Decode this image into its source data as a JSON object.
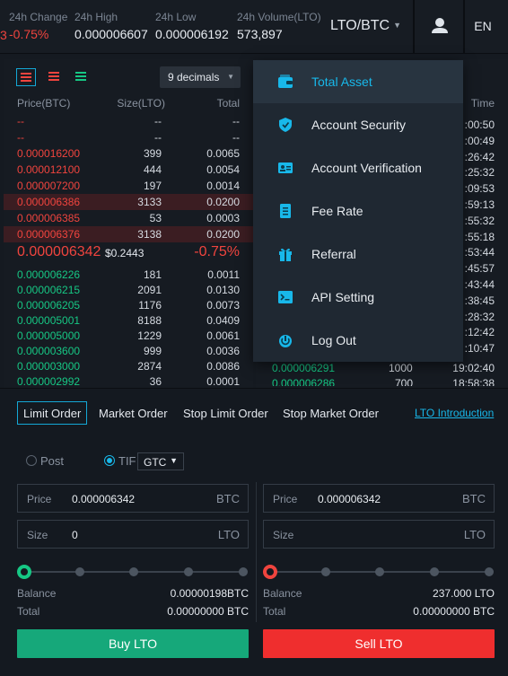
{
  "header": {
    "stats": [
      {
        "label": "24h Change",
        "value": "-0.75%"
      },
      {
        "label": "24h High",
        "value": "0.000006607"
      },
      {
        "label": "24h Low",
        "value": "0.000006192"
      },
      {
        "label": "24h Volume(LTO)",
        "value": "573,897"
      }
    ],
    "pair": "LTO/BTC",
    "lang": "EN",
    "prev_change_fragment": "3"
  },
  "orderbook": {
    "decimals": "9 decimals",
    "col_price": "Price(BTC)",
    "col_size": "Size(LTO)",
    "col_total": "Total",
    "asks": [
      {
        "price": "--",
        "size": "--",
        "total": "--"
      },
      {
        "price": "--",
        "size": "--",
        "total": "--"
      },
      {
        "price": "0.000016200",
        "size": "399",
        "total": "0.0065"
      },
      {
        "price": "0.000012100",
        "size": "444",
        "total": "0.0054"
      },
      {
        "price": "0.000007200",
        "size": "197",
        "total": "0.0014"
      },
      {
        "price": "0.000006386",
        "size": "3133",
        "total": "0.0200"
      },
      {
        "price": "0.000006385",
        "size": "53",
        "total": "0.0003"
      },
      {
        "price": "0.000006376",
        "size": "3138",
        "total": "0.0200"
      }
    ],
    "last_price": "0.000006342",
    "last_usd": "$0.2443",
    "last_change": "-0.75%",
    "bids": [
      {
        "price": "0.000006226",
        "size": "181",
        "total": "0.0011"
      },
      {
        "price": "0.000006215",
        "size": "2091",
        "total": "0.0130"
      },
      {
        "price": "0.000006205",
        "size": "1176",
        "total": "0.0073"
      },
      {
        "price": "0.000005001",
        "size": "8188",
        "total": "0.0409"
      },
      {
        "price": "0.000005000",
        "size": "1229",
        "total": "0.0061"
      },
      {
        "price": "0.000003600",
        "size": "999",
        "total": "0.0036"
      },
      {
        "price": "0.000003000",
        "size": "2874",
        "total": "0.0086"
      },
      {
        "price": "0.000002992",
        "size": "36",
        "total": "0.0001"
      }
    ]
  },
  "trades": {
    "col_time": "Time",
    "times": [
      ":00:50",
      ":00:49",
      ":26:42",
      ":25:32",
      ":09:53",
      ":59:13",
      ":55:32",
      ":55:18",
      ":53:44",
      ":45:57",
      ":43:44",
      ":38:45",
      ":28:32",
      ":12:42",
      ":10:47"
    ],
    "visible_row": {
      "price": "0.000006291",
      "size": "1000",
      "time": "19:02:40"
    },
    "cut_row": {
      "price": "0.000006286",
      "size": "700",
      "time": "18:58:38"
    }
  },
  "menu": {
    "items": [
      {
        "label": "Total Asset",
        "icon": "wallet-icon"
      },
      {
        "label": "Account Security",
        "icon": "shield-icon"
      },
      {
        "label": "Account Verification",
        "icon": "id-card-icon"
      },
      {
        "label": "Fee Rate",
        "icon": "document-icon"
      },
      {
        "label": "Referral",
        "icon": "gift-icon"
      },
      {
        "label": "API Setting",
        "icon": "terminal-icon"
      },
      {
        "label": "Log Out",
        "icon": "power-icon"
      }
    ]
  },
  "order_form": {
    "tabs": [
      "Limit Order",
      "Market Order",
      "Stop Limit Order",
      "Stop Market Order"
    ],
    "intro_link": "LTO Introduction",
    "post_label": "Post",
    "tif_label": "TIF",
    "tif_value": "GTC",
    "buy": {
      "price_label": "Price",
      "price_value": "0.000006342",
      "price_unit": "BTC",
      "size_label": "Size",
      "size_value": "0",
      "size_unit": "LTO",
      "balance_label": "Balance",
      "balance_value": "0.00000198BTC",
      "total_label": "Total",
      "total_value": "0.00000000 BTC",
      "button": "Buy LTO"
    },
    "sell": {
      "price_label": "Price",
      "price_value": "0.000006342",
      "price_unit": "BTC",
      "size_label": "Size",
      "size_value": "",
      "size_unit": "LTO",
      "balance_label": "Balance",
      "balance_value": "237.000 LTO",
      "total_label": "Total",
      "total_value": "0.00000000 BTC",
      "button": "Sell LTO"
    }
  },
  "colors": {
    "accent": "#18b8ea",
    "up": "#16c784",
    "down": "#f0443e",
    "buy_button": "#16a87a",
    "sell_button": "#ef2e2e"
  }
}
